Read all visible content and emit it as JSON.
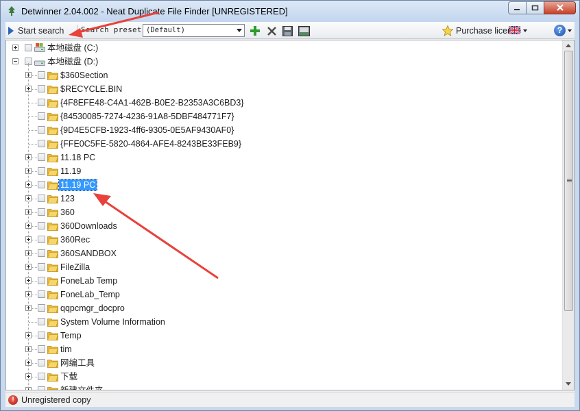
{
  "window": {
    "title": "Detwinner 2.04.002 - Neat Duplicate File Finder [UNREGISTERED]"
  },
  "toolbar": {
    "start_search_label": "Start search",
    "search_preset_label": "Search preset:",
    "search_preset_value": "(Default)",
    "purchase_label": "Purchase license",
    "icons": [
      "add-preset-icon",
      "delete-preset-icon",
      "save-preset-icon",
      "edit-preset-icon"
    ]
  },
  "tree": {
    "drives": [
      {
        "label": "本地磁盘 (C:)",
        "expanded": false
      },
      {
        "label": "本地磁盘 (D:)",
        "expanded": true
      }
    ],
    "items": [
      {
        "label": "$360Section",
        "expandable": true,
        "selected": false
      },
      {
        "label": "$RECYCLE.BIN",
        "expandable": true,
        "selected": false
      },
      {
        "label": "{4F8EFE48-C4A1-462B-B0E2-B2353A3C6BD3}",
        "expandable": false,
        "selected": false
      },
      {
        "label": "{84530085-7274-4236-91A8-5DBF484771F7}",
        "expandable": false,
        "selected": false
      },
      {
        "label": "{9D4E5CFB-1923-4ff6-9305-0E5AF9430AF0}",
        "expandable": false,
        "selected": false
      },
      {
        "label": "{FFE0C5FE-5820-4864-AFE4-8243BE33FEB9}",
        "expandable": false,
        "selected": false
      },
      {
        "label": "11.18 PC",
        "expandable": true,
        "selected": false
      },
      {
        "label": "11.19",
        "expandable": true,
        "selected": false
      },
      {
        "label": "11.19 PC",
        "expandable": true,
        "selected": true
      },
      {
        "label": "123",
        "expandable": true,
        "selected": false
      },
      {
        "label": "360",
        "expandable": true,
        "selected": false
      },
      {
        "label": "360Downloads",
        "expandable": true,
        "selected": false
      },
      {
        "label": "360Rec",
        "expandable": true,
        "selected": false
      },
      {
        "label": "360SANDBOX",
        "expandable": true,
        "selected": false
      },
      {
        "label": "FileZilla",
        "expandable": true,
        "selected": false
      },
      {
        "label": "FoneLab Temp",
        "expandable": true,
        "selected": false
      },
      {
        "label": "FoneLab_Temp",
        "expandable": true,
        "selected": false
      },
      {
        "label": "qqpcmgr_docpro",
        "expandable": true,
        "selected": false
      },
      {
        "label": "System Volume Information",
        "expandable": false,
        "selected": false
      },
      {
        "label": "Temp",
        "expandable": true,
        "selected": false
      },
      {
        "label": "tim",
        "expandable": true,
        "selected": false
      },
      {
        "label": "网编工具",
        "expandable": true,
        "selected": false
      },
      {
        "label": "下载",
        "expandable": true,
        "selected": false
      },
      {
        "label": "新建文件夹",
        "expandable": true,
        "selected": false
      }
    ]
  },
  "status": {
    "text": "Unregistered copy"
  },
  "colors": {
    "selection": "#3399ff",
    "annotation_arrow": "#e8423a",
    "folder": "#f2c94c"
  }
}
